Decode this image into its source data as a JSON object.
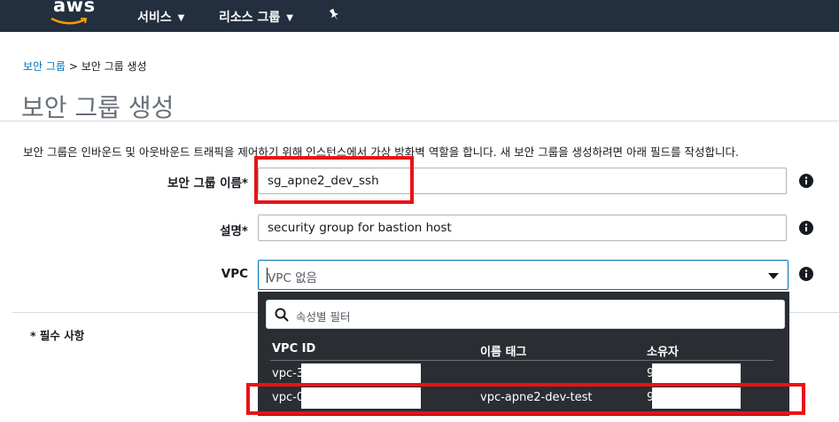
{
  "nav": {
    "logo": "aws",
    "services": "서비스",
    "resource_groups": "리소스 그룹"
  },
  "breadcrumb": {
    "parent": "보안 그룹",
    "separator": ">",
    "current": "보안 그룹 생성"
  },
  "page_title": "보안 그룹 생성",
  "description": "보안 그룹은 인바운드 및 아웃바운드 트래픽을 제어하기 위해 인스턴스에서 가상 방화벽 역할을 합니다. 새 보안 그룹을 생성하려면 아래 필드를 작성합니다.",
  "form": {
    "name_label": "보안 그룹 이름*",
    "name_value": "sg_apne2_dev_ssh",
    "desc_label": "설명*",
    "desc_value": "security group for bastion host",
    "vpc_label": "VPC",
    "vpc_value": "VPC 없음"
  },
  "required_note": "* 필수 사항",
  "dropdown": {
    "search_placeholder": "속성별 필터",
    "headers": [
      "VPC ID",
      "이름 태그",
      "소유자"
    ],
    "rows": [
      {
        "vpc_id": "vpc-3",
        "name_tag": "",
        "owner": "9"
      },
      {
        "vpc_id": "vpc-0",
        "name_tag": "vpc-apne2-dev-test",
        "owner": "9"
      }
    ]
  },
  "colors": {
    "nav_bg": "#232f3e",
    "link": "#0073bb",
    "highlight": "#e81316",
    "dropdown_bg": "#2a2e33"
  }
}
